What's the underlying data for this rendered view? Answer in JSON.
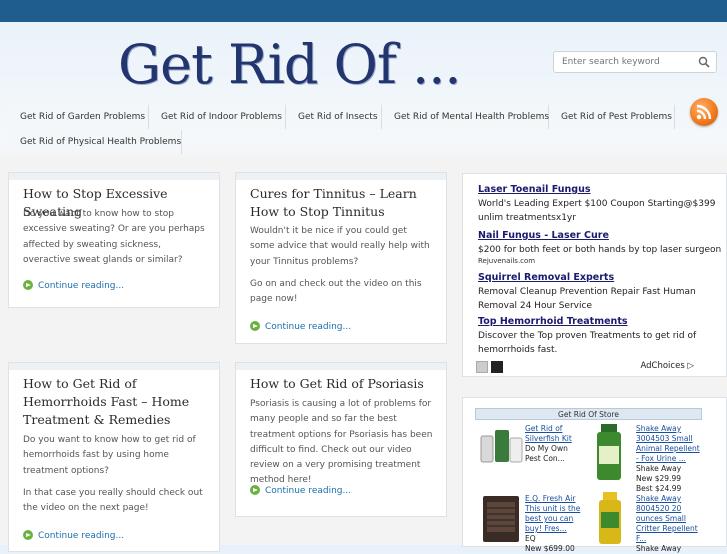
{
  "site": {
    "logo": "Get Rid Of ..."
  },
  "search": {
    "placeholder": "Enter search keyword"
  },
  "nav": {
    "items": [
      "Get Rid of Garden Problems",
      "Get Rid of Indoor Problems",
      "Get Rid of Insects",
      "Get Rid of Mental Health Problems",
      "Get Rid of Pest Problems",
      "Get Rid of Physical Health Problems"
    ]
  },
  "posts": [
    {
      "title": "How to Stop Excessive Sweating",
      "excerpt": "Do you want to know how to stop excessive sweating? Or are you perhaps affected by sweating sickness, overactive sweat glands or similar?",
      "more": "Continue reading..."
    },
    {
      "title": "Cures for Tinnitus – Learn How to Stop Tinnitus",
      "excerpt": "Wouldn't it be nice if you could get some advice that would really help with your Tinnitus problems?",
      "excerpt2": "Go on and check out the video on this page now!",
      "more": "Continue reading..."
    },
    {
      "title": "How to Get Rid of Hemorrhoids Fast – Home Treatment & Remedies",
      "excerpt": "Do you want to know how to get rid of hemorrhoids fast by using home treatment options?",
      "excerpt2": "In that case you really should check out the video on the next page!",
      "more": "Continue reading..."
    },
    {
      "title": "How to Get Rid of Psoriasis",
      "excerpt": "Psoriasis is causing a lot of problems for many people and so far the best treatment options for Psoriasis has been difficult to find. Check out our video review on a very promising treatment method here!",
      "more": "Continue reading..."
    }
  ],
  "ads": {
    "items": [
      {
        "title": "Laser Toenail Fungus",
        "desc": "World's Leading Expert $100 Coupon Starting@$399 unlim treatmentsx1yr",
        "url": ""
      },
      {
        "title": "Nail Fungus - Laser Cure",
        "desc": "$200 for both feet or both hands by top laser surgeon",
        "url": "Rejuvenails.com"
      },
      {
        "title": "Squirrel Removal Experts",
        "desc": "Removal Cleanup Prevention Repair Fast Human Removal 24 Hour Service",
        "url": ""
      },
      {
        "title": "Top Hemorrhoid Treatments",
        "desc": "Discover the Top proven Treatments to get rid of hemorrhoids fast.",
        "url": ""
      }
    ],
    "choices": "AdChoices"
  },
  "store": {
    "title": "Get Rid Of Store",
    "products": [
      {
        "name": "Get Rid of Silverfish Kit",
        "line2": "Do My Own Pest Con..."
      },
      {
        "name": "Shake Away 3004503 Small Animal Repellent - Fox Urine ...",
        "line2": "Shake Away",
        "line3": "New $29.99",
        "line4": "Best $24.99"
      },
      {
        "name": "E.Q. Fresh Air",
        "line2": "This unit is the best you can buy! Fres...",
        "line3": "EQ",
        "line4": "New $699.00"
      },
      {
        "name": "Shake Away 8004520 20 ounces Small Critter Repellent F...",
        "line2": "Shake Away"
      }
    ]
  },
  "colors": {
    "topband": "#1e5d8e",
    "logo": "#23356e",
    "link": "#1a6fb0",
    "rss": "#f07618"
  }
}
